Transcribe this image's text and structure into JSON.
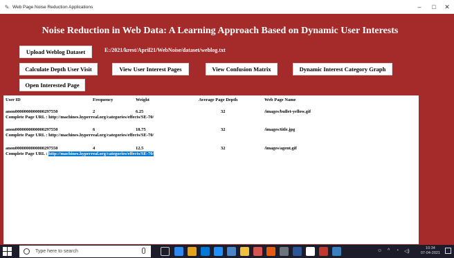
{
  "window": {
    "title": "Web Page Noise Reduction Applications",
    "controls": {
      "minimize": "–",
      "maximize": "□",
      "close": "✕"
    }
  },
  "heading": "Noise Reduction in Web Data: A Learning Approach Based on Dynamic User Interests",
  "dataset_path": "E:/2021/krest/April21/WebNoise/dataset/weblog.txt",
  "buttons": {
    "upload": "Upload Weblog Dataset",
    "depth": "Calculate Depth User Visit",
    "interest_pages": "View User Interest Pages",
    "confusion": "View Confusion Matrix",
    "category_graph": "Dynamic Interest Category Graph",
    "open_interested": "Open Interested Page"
  },
  "table": {
    "headers": [
      "User ID",
      "Frequency",
      "Weight",
      "Average Page Depth",
      "Web Page Name"
    ],
    "url_prefix": "Complete Page URL : ",
    "rows": [
      {
        "user_id": "anon0000000000000297550",
        "frequency": "2",
        "weight": "6.25",
        "avg_depth": "32",
        "page": "/images/bullet-yellow.gif",
        "url": "http://machines.hyperreal.org/categories/effects/SE-70/"
      },
      {
        "user_id": "anon0000000000000297550",
        "frequency": "6",
        "weight": "18.75",
        "avg_depth": "32",
        "page": "/images/title.jpg",
        "url": "http://machines.hyperreal.org/categories/effects/SE-70/"
      },
      {
        "user_id": "anon0000000000000297550",
        "frequency": "4",
        "weight": "12.5",
        "avg_depth": "32",
        "page": "/images/agent.gif",
        "url": "http://machines.hyperreal.org/categories/effects/SE-70/"
      }
    ]
  },
  "taskbar": {
    "search_placeholder": "Type here to search",
    "time": "10:34",
    "date": "07-04-2021"
  },
  "colors": {
    "accent": "#a52a2a",
    "selection": "#0078d7",
    "taskbar": "#1c1c2a"
  }
}
